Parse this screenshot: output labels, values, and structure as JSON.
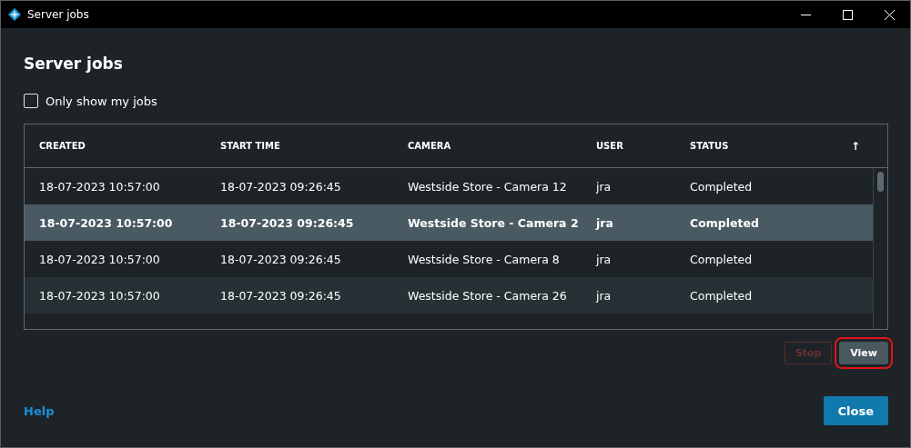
{
  "window": {
    "title": "Server jobs"
  },
  "heading": "Server jobs",
  "filter": {
    "label": "Only show my jobs",
    "checked": false
  },
  "table": {
    "columns": [
      "CREATED",
      "START TIME",
      "CAMERA",
      "USER",
      "STATUS"
    ],
    "sort_indicator": "↑",
    "rows": [
      {
        "cells": [
          "18-07-2023 10:57:00",
          "18-07-2023 09:26:45",
          "Westside Store - Camera 12",
          "jra",
          "Completed"
        ],
        "selected": false
      },
      {
        "cells": [
          "18-07-2023 10:57:00",
          "18-07-2023 09:26:45",
          "Westside Store - Camera 2",
          "jra",
          "Completed"
        ],
        "selected": true
      },
      {
        "cells": [
          "18-07-2023 10:57:00",
          "18-07-2023 09:26:45",
          "Westside Store - Camera 8",
          "jra",
          "Completed"
        ],
        "selected": false
      },
      {
        "cells": [
          "18-07-2023 10:57:00",
          "18-07-2023 09:26:45",
          "Westside Store - Camera 26",
          "jra",
          "Completed"
        ],
        "selected": false
      }
    ]
  },
  "actions": [
    {
      "label": "Stop",
      "disabled": true,
      "highlighted": false
    },
    {
      "label": "View",
      "disabled": false,
      "highlighted": true
    }
  ],
  "help_link": "Help",
  "close_button": "Close"
}
